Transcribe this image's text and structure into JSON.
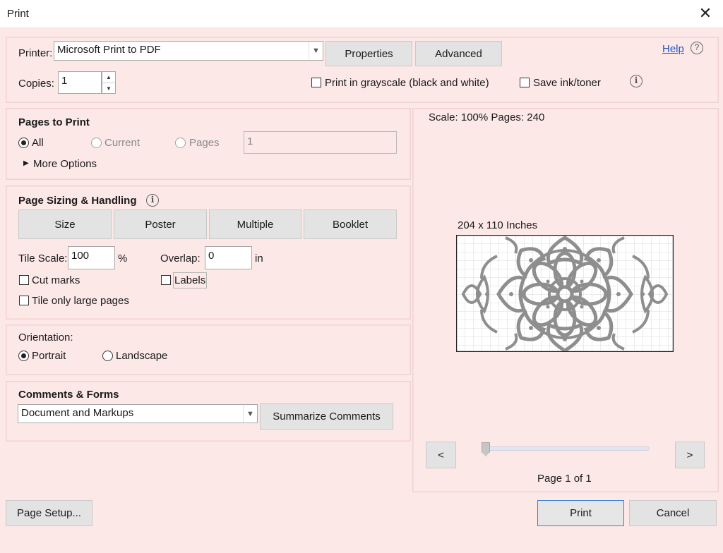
{
  "window": {
    "title": "Print",
    "close_symbol": "✕"
  },
  "printer": {
    "label": "Printer:",
    "value": "Microsoft Print to PDF",
    "properties_label": "Properties",
    "advanced_label": "Advanced",
    "help_label": "Help",
    "copies_label": "Copies:",
    "copies_value": "1",
    "grayscale_label": "Print in grayscale (black and white)",
    "save_ink_label": "Save ink/toner"
  },
  "pages_to_print": {
    "heading": "Pages to Print",
    "all_label": "All",
    "current_label": "Current",
    "pages_label": "Pages",
    "pages_value": "1",
    "more_options_label": "More Options"
  },
  "page_sizing": {
    "heading": "Page Sizing & Handling",
    "tabs": [
      "Size",
      "Poster",
      "Multiple",
      "Booklet"
    ],
    "tile_scale_label": "Tile Scale:",
    "tile_scale_value": "100",
    "tile_scale_unit": "%",
    "overlap_label": "Overlap:",
    "overlap_value": "0",
    "overlap_unit": "in",
    "cut_marks_label": "Cut marks",
    "labels_label": "Labels",
    "tile_large_label": "Tile only large pages"
  },
  "orientation": {
    "heading": "Orientation:",
    "portrait_label": "Portrait",
    "landscape_label": "Landscape",
    "selected": "Portrait"
  },
  "comments_forms": {
    "heading": "Comments & Forms",
    "value": "Document and Markups",
    "summarize_label": "Summarize Comments"
  },
  "preview": {
    "scale_text": "Scale: 100% Pages: 240",
    "size_text": "204 x 110 Inches",
    "prev_label": "<",
    "next_label": ">",
    "page_text": "Page 1 of 1",
    "slider_fraction": 0.0
  },
  "footer": {
    "page_setup_label": "Page Setup...",
    "print_label": "Print",
    "cancel_label": "Cancel"
  },
  "colors": {
    "background": "#fde8e8",
    "button": "#e3e3e3",
    "primary_border": "#3b7fd6",
    "link": "#1a55c8",
    "preview_art": "#8e8e8e"
  }
}
